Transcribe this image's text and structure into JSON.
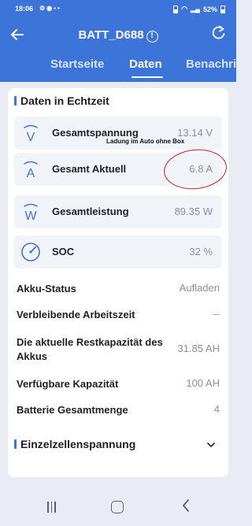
{
  "status_bar": {
    "time": "18:06",
    "battery_pct": "52%"
  },
  "header": {
    "title": "BATT_D688",
    "info_glyph": "!",
    "back_icon": "arrow-left-icon",
    "refresh_icon": "refresh-icon"
  },
  "tabs": [
    {
      "label": "Startseite",
      "active": false
    },
    {
      "label": "Daten",
      "active": true
    },
    {
      "label": "Benachri",
      "active": false
    }
  ],
  "section_realtime": {
    "title": "Daten in Echtzeit"
  },
  "metrics": [
    {
      "icon": "voltage-icon",
      "icon_letter": "V",
      "label": "Gesamtspannung",
      "value": "13.14 V"
    },
    {
      "icon": "current-icon",
      "icon_letter": "A",
      "label": "Gesamt Aktuell",
      "value": "6.8 A"
    },
    {
      "icon": "power-icon",
      "icon_letter": "W",
      "label": "Gesamtleistung",
      "value": "89.35 W"
    },
    {
      "icon": "gauge-icon",
      "icon_letter": "",
      "label": "SOC",
      "value": "32 %"
    }
  ],
  "rows": [
    {
      "label": "Akku-Status",
      "value": "Aufladen"
    },
    {
      "label": "Verbleibende Arbeitszeit",
      "value": "--"
    },
    {
      "label": "Die aktuelle Restkapazität des Akkus",
      "value": "31.85 AH"
    },
    {
      "label": "Verfügbare Kapazität",
      "value": "100 AH"
    },
    {
      "label": "Batterie Gesamtmenge",
      "value": "4"
    }
  ],
  "section_cells": {
    "title": "Einzelzellenspannung"
  },
  "annotation": {
    "text": "Ladung im Auto ohne Box",
    "color": "#d11b1b"
  },
  "colors": {
    "primary": "#3d74d9",
    "background": "#e9edf3",
    "card": "#ffffff",
    "value_gray": "#8c9098"
  }
}
